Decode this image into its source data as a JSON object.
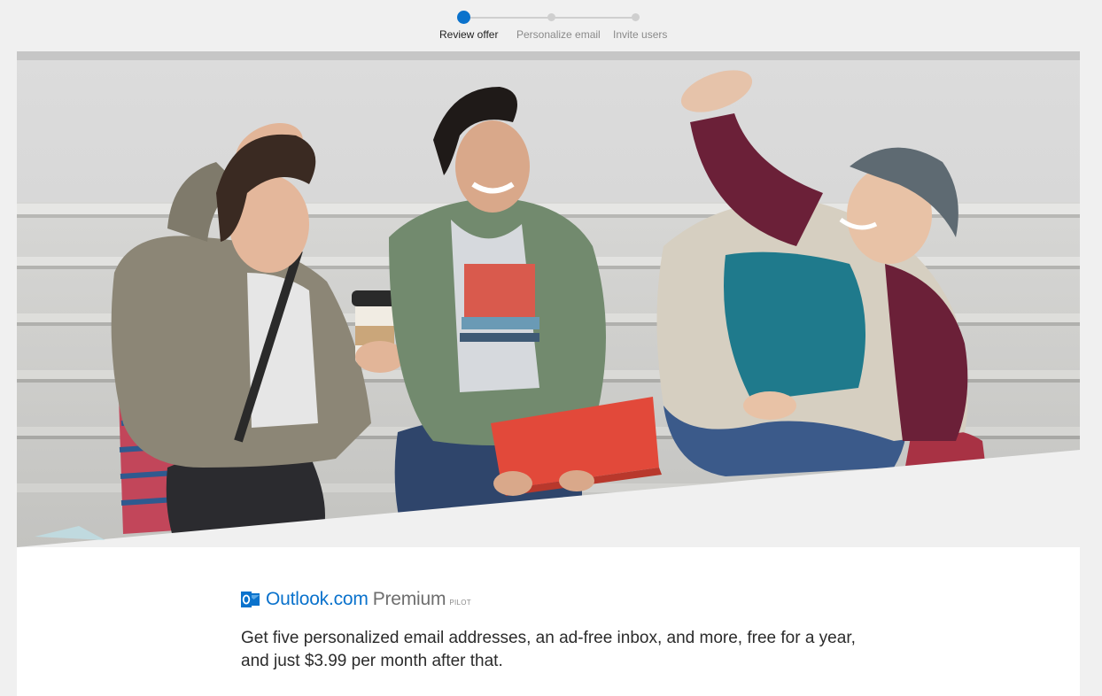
{
  "stepper": {
    "steps": [
      {
        "label": "Review offer",
        "active": true
      },
      {
        "label": "Personalize email",
        "active": false
      },
      {
        "label": "Invite users",
        "active": false
      }
    ]
  },
  "hero": {
    "icon": "hero-photo-image"
  },
  "brand": {
    "name": "Outlook.com",
    "premium": "Premium",
    "pilot": "PILOT",
    "icon": "outlook-logo-icon",
    "color": "#0a72cc"
  },
  "offer": {
    "text": "Get five personalized email addresses, an ad-free inbox, and more, free for a year, and just $3.99 per month after that."
  },
  "colors": {
    "accent": "#0a72cc",
    "background": "#f0f0f0",
    "inactive_step": "#cfcfcf"
  }
}
